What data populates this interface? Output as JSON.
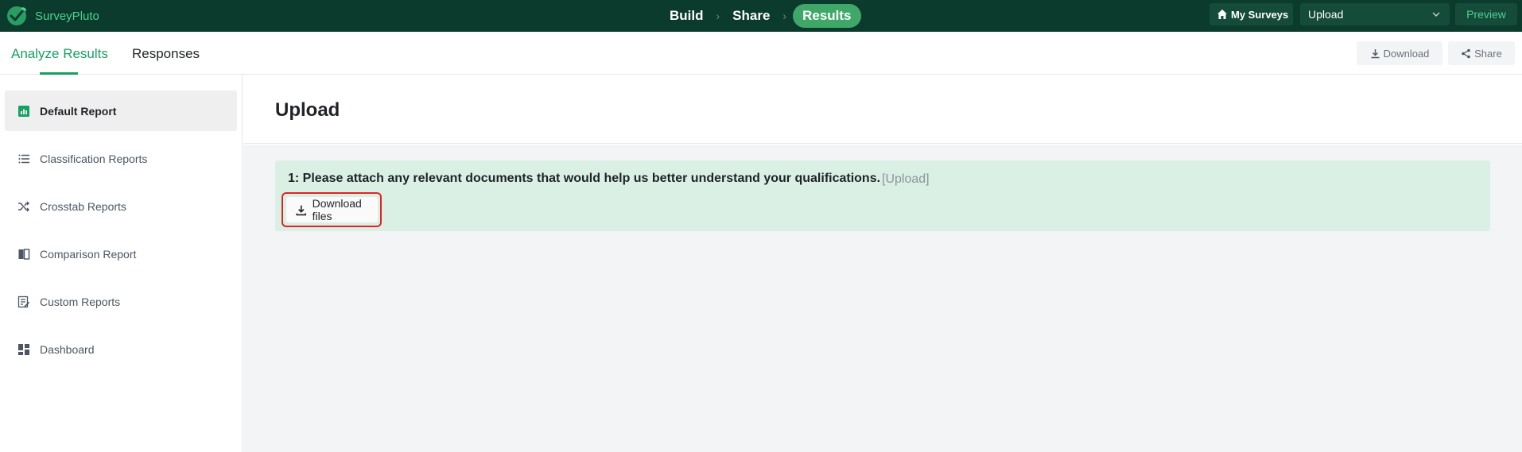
{
  "brand": {
    "name": "SurveyPluto"
  },
  "steps": [
    {
      "label": "Build"
    },
    {
      "label": "Share"
    },
    {
      "label": "Results"
    }
  ],
  "topbar": {
    "my_surveys_label": "My Surveys",
    "survey_select_value": "Upload",
    "preview_label": "Preview"
  },
  "tabs": {
    "analyze": "Analyze Results",
    "responses": "Responses"
  },
  "actions": {
    "download_label": "Download",
    "share_label": "Share"
  },
  "sidebar": {
    "items": [
      {
        "label": "Default Report",
        "icon": "bar-chart-icon",
        "active": true
      },
      {
        "label": "Classification Reports",
        "icon": "list-icon"
      },
      {
        "label": "Crosstab Reports",
        "icon": "shuffle-icon"
      },
      {
        "label": "Comparison Report",
        "icon": "compare-icon"
      },
      {
        "label": "Custom Reports",
        "icon": "edit-list-icon"
      },
      {
        "label": "Dashboard",
        "icon": "grid-icon"
      }
    ]
  },
  "page": {
    "title": "Upload"
  },
  "question": {
    "text": "1: Please attach any relevant documents that would help us better understand your qualifications.",
    "type_tag": "[Upload]",
    "download_files_label": "Download files"
  },
  "colors": {
    "topbar_bg": "#0b3b2c",
    "brand_green": "#16a061",
    "results_active": "#3fa869",
    "question_bg": "#daf0e4",
    "highlight_red": "#e02424"
  }
}
